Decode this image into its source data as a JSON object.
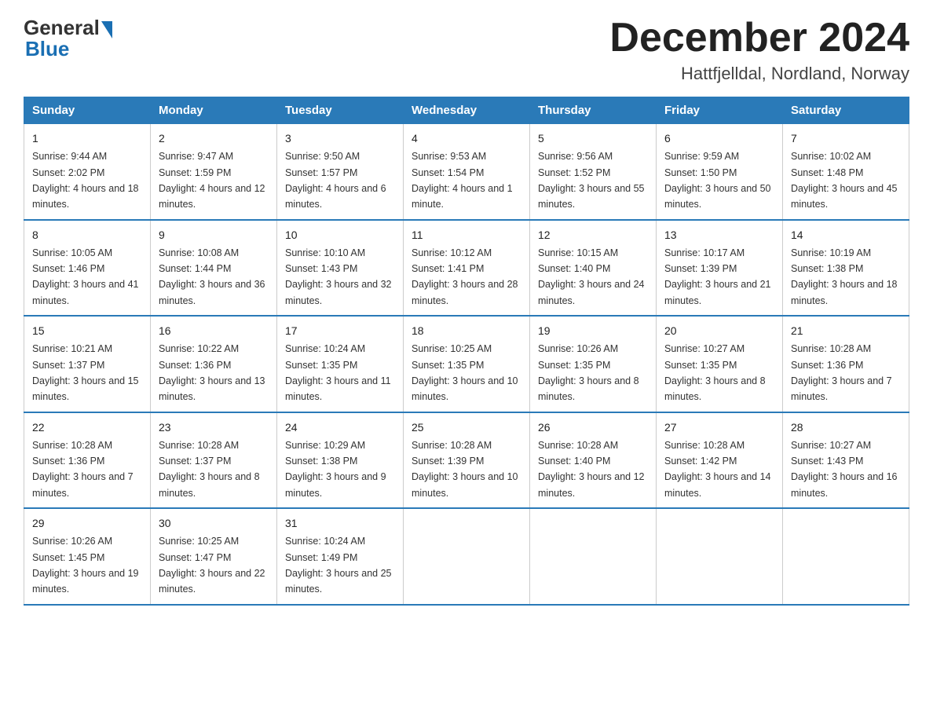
{
  "logo": {
    "general": "General",
    "blue": "Blue"
  },
  "title": "December 2024",
  "location": "Hattfjelldal, Nordland, Norway",
  "days_of_week": [
    "Sunday",
    "Monday",
    "Tuesday",
    "Wednesday",
    "Thursday",
    "Friday",
    "Saturday"
  ],
  "weeks": [
    [
      {
        "day": "1",
        "sunrise": "9:44 AM",
        "sunset": "2:02 PM",
        "daylight": "4 hours and 18 minutes."
      },
      {
        "day": "2",
        "sunrise": "9:47 AM",
        "sunset": "1:59 PM",
        "daylight": "4 hours and 12 minutes."
      },
      {
        "day": "3",
        "sunrise": "9:50 AM",
        "sunset": "1:57 PM",
        "daylight": "4 hours and 6 minutes."
      },
      {
        "day": "4",
        "sunrise": "9:53 AM",
        "sunset": "1:54 PM",
        "daylight": "4 hours and 1 minute."
      },
      {
        "day": "5",
        "sunrise": "9:56 AM",
        "sunset": "1:52 PM",
        "daylight": "3 hours and 55 minutes."
      },
      {
        "day": "6",
        "sunrise": "9:59 AM",
        "sunset": "1:50 PM",
        "daylight": "3 hours and 50 minutes."
      },
      {
        "day": "7",
        "sunrise": "10:02 AM",
        "sunset": "1:48 PM",
        "daylight": "3 hours and 45 minutes."
      }
    ],
    [
      {
        "day": "8",
        "sunrise": "10:05 AM",
        "sunset": "1:46 PM",
        "daylight": "3 hours and 41 minutes."
      },
      {
        "day": "9",
        "sunrise": "10:08 AM",
        "sunset": "1:44 PM",
        "daylight": "3 hours and 36 minutes."
      },
      {
        "day": "10",
        "sunrise": "10:10 AM",
        "sunset": "1:43 PM",
        "daylight": "3 hours and 32 minutes."
      },
      {
        "day": "11",
        "sunrise": "10:12 AM",
        "sunset": "1:41 PM",
        "daylight": "3 hours and 28 minutes."
      },
      {
        "day": "12",
        "sunrise": "10:15 AM",
        "sunset": "1:40 PM",
        "daylight": "3 hours and 24 minutes."
      },
      {
        "day": "13",
        "sunrise": "10:17 AM",
        "sunset": "1:39 PM",
        "daylight": "3 hours and 21 minutes."
      },
      {
        "day": "14",
        "sunrise": "10:19 AM",
        "sunset": "1:38 PM",
        "daylight": "3 hours and 18 minutes."
      }
    ],
    [
      {
        "day": "15",
        "sunrise": "10:21 AM",
        "sunset": "1:37 PM",
        "daylight": "3 hours and 15 minutes."
      },
      {
        "day": "16",
        "sunrise": "10:22 AM",
        "sunset": "1:36 PM",
        "daylight": "3 hours and 13 minutes."
      },
      {
        "day": "17",
        "sunrise": "10:24 AM",
        "sunset": "1:35 PM",
        "daylight": "3 hours and 11 minutes."
      },
      {
        "day": "18",
        "sunrise": "10:25 AM",
        "sunset": "1:35 PM",
        "daylight": "3 hours and 10 minutes."
      },
      {
        "day": "19",
        "sunrise": "10:26 AM",
        "sunset": "1:35 PM",
        "daylight": "3 hours and 8 minutes."
      },
      {
        "day": "20",
        "sunrise": "10:27 AM",
        "sunset": "1:35 PM",
        "daylight": "3 hours and 8 minutes."
      },
      {
        "day": "21",
        "sunrise": "10:28 AM",
        "sunset": "1:36 PM",
        "daylight": "3 hours and 7 minutes."
      }
    ],
    [
      {
        "day": "22",
        "sunrise": "10:28 AM",
        "sunset": "1:36 PM",
        "daylight": "3 hours and 7 minutes."
      },
      {
        "day": "23",
        "sunrise": "10:28 AM",
        "sunset": "1:37 PM",
        "daylight": "3 hours and 8 minutes."
      },
      {
        "day": "24",
        "sunrise": "10:29 AM",
        "sunset": "1:38 PM",
        "daylight": "3 hours and 9 minutes."
      },
      {
        "day": "25",
        "sunrise": "10:28 AM",
        "sunset": "1:39 PM",
        "daylight": "3 hours and 10 minutes."
      },
      {
        "day": "26",
        "sunrise": "10:28 AM",
        "sunset": "1:40 PM",
        "daylight": "3 hours and 12 minutes."
      },
      {
        "day": "27",
        "sunrise": "10:28 AM",
        "sunset": "1:42 PM",
        "daylight": "3 hours and 14 minutes."
      },
      {
        "day": "28",
        "sunrise": "10:27 AM",
        "sunset": "1:43 PM",
        "daylight": "3 hours and 16 minutes."
      }
    ],
    [
      {
        "day": "29",
        "sunrise": "10:26 AM",
        "sunset": "1:45 PM",
        "daylight": "3 hours and 19 minutes."
      },
      {
        "day": "30",
        "sunrise": "10:25 AM",
        "sunset": "1:47 PM",
        "daylight": "3 hours and 22 minutes."
      },
      {
        "day": "31",
        "sunrise": "10:24 AM",
        "sunset": "1:49 PM",
        "daylight": "3 hours and 25 minutes."
      },
      null,
      null,
      null,
      null
    ]
  ]
}
